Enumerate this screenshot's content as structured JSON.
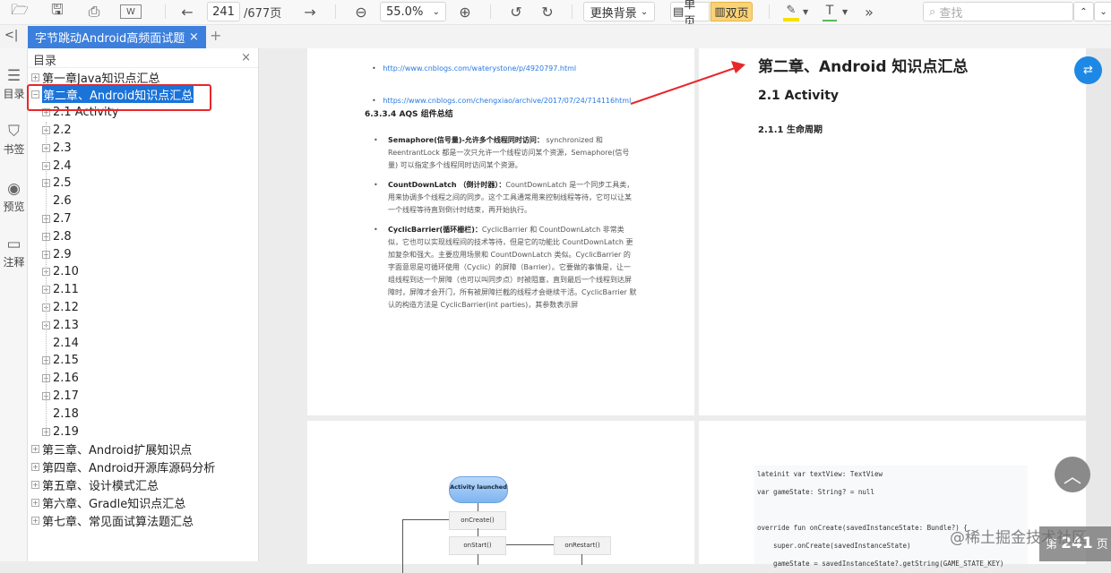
{
  "toolbar": {
    "page_current": "241",
    "page_total": "/677页",
    "zoom": "55.0%",
    "bg_button": "更换背景",
    "single_page": "单页",
    "double_page": "双页",
    "search_placeholder": "查找"
  },
  "tab": {
    "title": "字节跳动Android高频面试题解析",
    "close": "×",
    "add": "+"
  },
  "rail": {
    "toc": "目录",
    "bookmarks": "书签",
    "preview": "预览",
    "notes": "注释"
  },
  "toc": {
    "title": "目录",
    "close": "×",
    "chapters_before": [
      {
        "label": "第一章Java知识点汇总"
      }
    ],
    "selected": {
      "label": "第二章、Android知识点汇总"
    },
    "children": [
      {
        "label": "2.1 Activity",
        "exp": true
      },
      {
        "label": "2.2",
        "exp": true
      },
      {
        "label": "2.3",
        "exp": true
      },
      {
        "label": "2.4",
        "exp": true
      },
      {
        "label": "2.5",
        "exp": true
      },
      {
        "label": "2.6",
        "exp": false
      },
      {
        "label": "2.7",
        "exp": true
      },
      {
        "label": "2.8",
        "exp": true
      },
      {
        "label": "2.9",
        "exp": true
      },
      {
        "label": "2.10",
        "exp": true
      },
      {
        "label": "2.11",
        "exp": true
      },
      {
        "label": "2.12",
        "exp": true
      },
      {
        "label": "2.13",
        "exp": true
      },
      {
        "label": "2.14",
        "exp": false
      },
      {
        "label": "2.15",
        "exp": true
      },
      {
        "label": "2.16",
        "exp": true
      },
      {
        "label": "2.17",
        "exp": true
      },
      {
        "label": "2.18",
        "exp": false
      },
      {
        "label": "2.19",
        "exp": true
      }
    ],
    "chapters_after": [
      {
        "label": "第三章、Android扩展知识点"
      },
      {
        "label": "第四章、Android开源库源码分析"
      },
      {
        "label": "第五章、设计模式汇总"
      },
      {
        "label": "第六章、Gradle知识点汇总"
      },
      {
        "label": "第七章、常见面试算法题汇总"
      }
    ]
  },
  "left_page": {
    "links": [
      "http://www.cnblogs.com/waterystone/p/4920797.html",
      "https://www.cnblogs.com/chengxiao/archive/2017/07/24/714116html"
    ],
    "heading": "6.3.3.4 AQS  组件总结",
    "items": [
      {
        "bold": "Semaphore(信号量)-允许多个线程同时访问：",
        "text": " synchronized 和 ReentrantLock 都是一次只允许一个线程访问某个资源，Semaphore(信号量) 可以指定多个线程同时访问某个资源。"
      },
      {
        "bold": "CountDownLatch （倒计时器）：",
        "text": "CountDownLatch 是一个同步工具类，用来协调多个线程之间的同步。这个工具通常用来控制线程等待，它可以让某一个线程等待直到倒计时结束，再开始执行。"
      },
      {
        "bold": "CyclicBarrier(循环栅栏)：",
        "text": "CyclicBarrier 和 CountDownLatch 非常类似，它也可以实现线程间的技术等待，但是它的功能比 CountDownLatch 更加复杂和强大。主要应用场景和 CountDownLatch 类似。CyclicBarrier 的字面意思是可循环使用（Cyclic）的屏障（Barrier）。它要做的事情是，让一组线程到达一个屏障（也可以叫同步点）时被阻塞，直到最后一个线程到达屏障时，屏障才会开门，所有被屏障拦截的线程才会继续干活。CyclicBarrier 默认的构造方法是 CyclicBarrier(int parties)，其参数表示屏"
      }
    ]
  },
  "right_page": {
    "chapter": "第二章、Android 知识点汇总",
    "section": "2.1 Activity",
    "subsection": "2.1.1  生命周期"
  },
  "diagram": {
    "launched": "Activity launched",
    "oncreate": "onCreate()",
    "onstart": "onStart()",
    "onrestart": "onRestart()"
  },
  "code": [
    "lateinit var textView: TextView",
    "var gameState: String? = null",
    "",
    "override fun onCreate(savedInstanceState: Bundle?) {",
    "    super.onCreate(savedInstanceState)",
    "    gameState = savedInstanceState?.getString(GAME_STATE_KEY)"
  ],
  "watermark": "@稀土掘金技术社区",
  "page_badge": {
    "prefix": "第",
    "num": "241",
    "suffix": "页"
  }
}
